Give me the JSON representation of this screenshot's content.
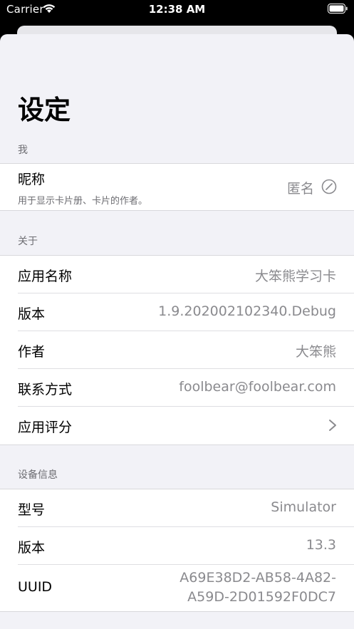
{
  "status_bar": {
    "carrier": "Carrier",
    "time": "12:38 AM"
  },
  "page": {
    "title": "设定"
  },
  "sections": {
    "me": {
      "header": "我",
      "nickname": {
        "label": "昵称",
        "subtitle": "用于显示卡片册、卡片的作者。",
        "value": "匿名"
      }
    },
    "about": {
      "header": "关于",
      "rows": [
        {
          "label": "应用名称",
          "value": "大笨熊学习卡"
        },
        {
          "label": "版本",
          "value": "1.9.202002102340.Debug"
        },
        {
          "label": "作者",
          "value": "大笨熊"
        },
        {
          "label": "联系方式",
          "value": "foolbear@foolbear.com"
        },
        {
          "label": "应用评分",
          "value": ""
        }
      ]
    },
    "device": {
      "header": "设备信息",
      "rows": [
        {
          "label": "型号",
          "value": "Simulator"
        },
        {
          "label": "版本",
          "value": "13.3"
        },
        {
          "label": "UUID",
          "value_line1": "A69E38D2-AB58-4A82-",
          "value_line2": "A59D-2D01592F0DC7"
        }
      ]
    }
  },
  "icons": {
    "wifi": "wifi-icon",
    "battery": "battery-icon",
    "edit": "edit-icon",
    "chevron": "chevron-right-icon"
  }
}
